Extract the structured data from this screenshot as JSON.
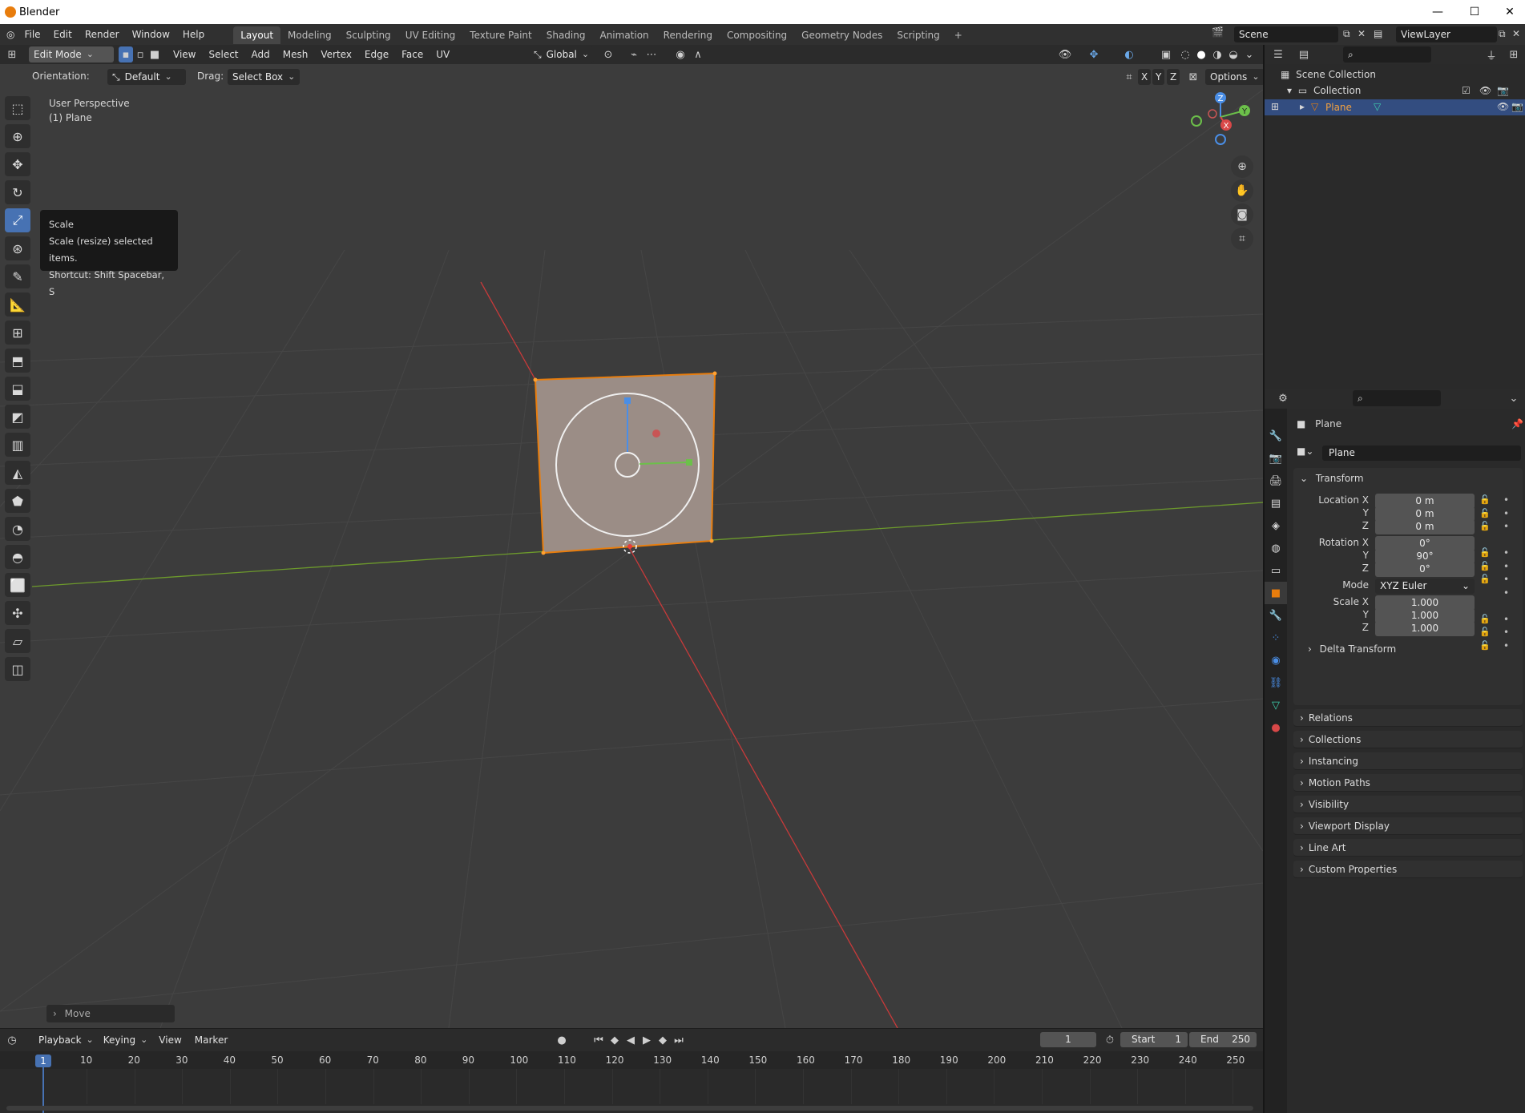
{
  "window": {
    "title": "Blender",
    "minimize": "—",
    "maximize": "☐",
    "close": "✕"
  },
  "menu": [
    "File",
    "Edit",
    "Render",
    "Window",
    "Help"
  ],
  "workspaces": [
    "Layout",
    "Modeling",
    "Sculpting",
    "UV Editing",
    "Texture Paint",
    "Shading",
    "Animation",
    "Rendering",
    "Compositing",
    "Geometry Nodes",
    "Scripting"
  ],
  "workspace_add": "+",
  "scene": {
    "name": "Scene",
    "view_layer": "ViewLayer"
  },
  "viewport_header": {
    "mode": "Edit Mode",
    "menus": [
      "View",
      "Select",
      "Add",
      "Mesh",
      "Vertex",
      "Edge",
      "Face",
      "UV"
    ],
    "transform_orientation": "Global"
  },
  "tool_settings": {
    "orientation_label": "Orientation:",
    "orientation_value": "Default",
    "drag_label": "Drag:",
    "drag_value": "Select Box",
    "axis_x": "X",
    "axis_y": "Y",
    "axis_z": "Z",
    "options": "Options"
  },
  "viewport_info": {
    "line1": "User Perspective",
    "line2": "(1) Plane"
  },
  "tooltip": {
    "title": "Scale",
    "description": "Scale (resize) selected items.",
    "shortcut": "Shortcut: Shift Spacebar, S"
  },
  "gizmo": {
    "z": "Z",
    "y": "Y",
    "x": "X"
  },
  "last_operator": "Move",
  "outliner": {
    "scene_collection": "Scene Collection",
    "collection": "Collection",
    "object": "Plane"
  },
  "properties": {
    "object_name": "Plane",
    "data_name": "Plane",
    "transform": {
      "title": "Transform",
      "location_label": "Location X",
      "location": [
        "0 m",
        "0 m",
        "0 m"
      ],
      "rotation_label": "Rotation X",
      "rotation": [
        "0°",
        "90°",
        "0°"
      ],
      "mode_label": "Mode",
      "mode_value": "XYZ Euler",
      "scale_label": "Scale X",
      "scale": [
        "1.000",
        "1.000",
        "1.000"
      ],
      "axis_y": "Y",
      "axis_z": "Z",
      "delta": "Delta Transform"
    },
    "panels": [
      "Relations",
      "Collections",
      "Instancing",
      "Motion Paths",
      "Visibility",
      "Viewport Display",
      "Line Art",
      "Custom Properties"
    ]
  },
  "timeline": {
    "menus": [
      "Playback",
      "Keying",
      "View",
      "Marker"
    ],
    "current_frame": "1",
    "start_label": "Start",
    "start": "1",
    "end_label": "End",
    "end": "250",
    "ticks": [
      "1",
      "10",
      "20",
      "30",
      "40",
      "50",
      "60",
      "70",
      "80",
      "90",
      "100",
      "110",
      "120",
      "130",
      "140",
      "150",
      "160",
      "170",
      "180",
      "190",
      "200",
      "210",
      "220",
      "230",
      "240",
      "250"
    ]
  },
  "colors": {
    "accent": "#4772b3",
    "selection": "#e87d0d",
    "x_axis": "#c83a3a",
    "y_axis": "#6d9a2c"
  }
}
